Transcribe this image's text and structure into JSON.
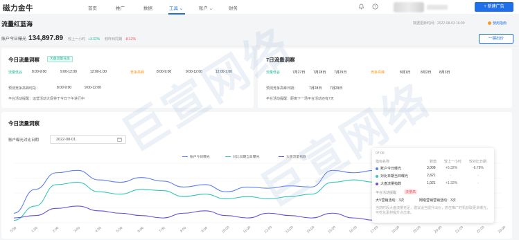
{
  "app": {
    "logo": "磁力金牛"
  },
  "nav": {
    "items": [
      {
        "label": "首页"
      },
      {
        "label": "推广"
      },
      {
        "label": "数据"
      },
      {
        "label": "工具 ⌄"
      },
      {
        "label": "账户 ⌄"
      },
      {
        "label": "财务"
      }
    ],
    "active_index": 3
  },
  "header": {
    "new_ad_label": "+ 新建广告"
  },
  "page": {
    "title": "流量红蓝海",
    "updated_text": "数据更新时间：2022-08-03 16:00",
    "help_text": "使用指南",
    "exposure_label": "账户今日曝光",
    "exposure_value": "134,897.89",
    "vs_hour_label": "较上一小时",
    "vs_hour_value": "+3.32%",
    "vs_yesterday_label": "较昨日同期",
    "vs_yesterday_value": "-8.12%",
    "one_click_button": "一键出价"
  },
  "today_card": {
    "title": "今日流量洞察",
    "tag": "大盘流量充足",
    "low_label": "流量低谷",
    "low_slots": [
      "8:00-9:00",
      "9:00-12:00",
      "12:00-1:00"
    ],
    "high_label": "竞争高峰",
    "high_slots": [
      "8:00-9:00",
      "9:00-12:00",
      "12:00-1:00"
    ],
    "suggest_label": "预测竞争高峰时段：",
    "suggest_slots": [
      "8:00-9:00",
      "9:00-12:00"
    ],
    "event_text": "平台活动提醒：运营活动大促将于今日下午进行中"
  },
  "week_card": {
    "title": "7日流量洞察",
    "low_label": "流量低谷",
    "low_dates": [
      "7月27日",
      "7月28日",
      "7月29日"
    ],
    "high_label": "竞争高峰",
    "high_dates": [
      "8月1日",
      "8月2日",
      "8月3日"
    ],
    "suggest_label": "预测竞争高峰日期：",
    "suggest_dates": [
      "7月28日",
      "7月29日"
    ],
    "event_text": "平台活动提醒：距离下一场平台活动还有7天"
  },
  "chart_card": {
    "title": "今日流量洞察",
    "compare_label": "账户曝光对比日期",
    "compare_date": "2022-08-01"
  },
  "chart_data": {
    "type": "line",
    "x": [
      "0:00",
      "1:00",
      "2:00",
      "3:00",
      "4:00",
      "5:00",
      "6:00",
      "7:00",
      "8:00",
      "9:00",
      "10:00",
      "11:00",
      "12:00",
      "13:00",
      "14:00",
      "15:00",
      "16:00",
      "17:00",
      "18:00",
      "19:00",
      "20:00",
      "21:00",
      "22:00",
      "23:00"
    ],
    "series": [
      {
        "name": "账户今日曝光",
        "color": "#5b7ff5",
        "values": [
          8,
          28,
          42,
          44,
          36,
          34,
          38,
          35,
          30,
          32,
          26,
          30,
          29,
          31,
          30,
          44,
          42,
          44
        ]
      },
      {
        "name": "对比日期当日曝光",
        "color": "#34c6b6",
        "values": [
          2,
          14,
          32,
          34,
          26,
          24,
          28,
          27,
          22,
          24,
          20,
          22,
          20,
          22,
          24,
          34,
          36,
          34
        ]
      },
      {
        "name": "大盘流量指数",
        "color": "#6a4fd6",
        "values": [
          4,
          6,
          12,
          14,
          10,
          8,
          6,
          4,
          8,
          10,
          6,
          4,
          8,
          6,
          4,
          8,
          4,
          2
        ]
      }
    ],
    "ylim": [
      0,
      50
    ],
    "grid": true,
    "legend": "top-right"
  },
  "tooltip": {
    "time": "07:00",
    "headers": [
      "指标名称",
      "数值",
      "较上一小时",
      "较对比日期"
    ],
    "rows": [
      {
        "name": "账户今日曝光",
        "value": "3,009",
        "vs_hour": "+5.32%",
        "vs_compare": "-6.78%",
        "color": "#5b7ff5"
      },
      {
        "name": "对比日期当日曝光",
        "value": "2,821",
        "vs_hour": "-",
        "vs_compare": "-",
        "color": "#34c6b6"
      },
      {
        "name": "大盘流量指数",
        "value": "1,021",
        "vs_hour": "+1.32%",
        "vs_compare": "-",
        "color": "#6a4fd6"
      }
    ],
    "event_label": "平台活动提醒",
    "event_tag": "流量高",
    "event_a": "大V营销活动：3次",
    "event_b": "网络营销营销活动：3次",
    "note": "当前时段大盘流量充足，建议适当提升出价，抓住推广时机获取更多曝光，可优化素材提升点击率。"
  },
  "watermark": {
    "text": "巨宣网络"
  }
}
